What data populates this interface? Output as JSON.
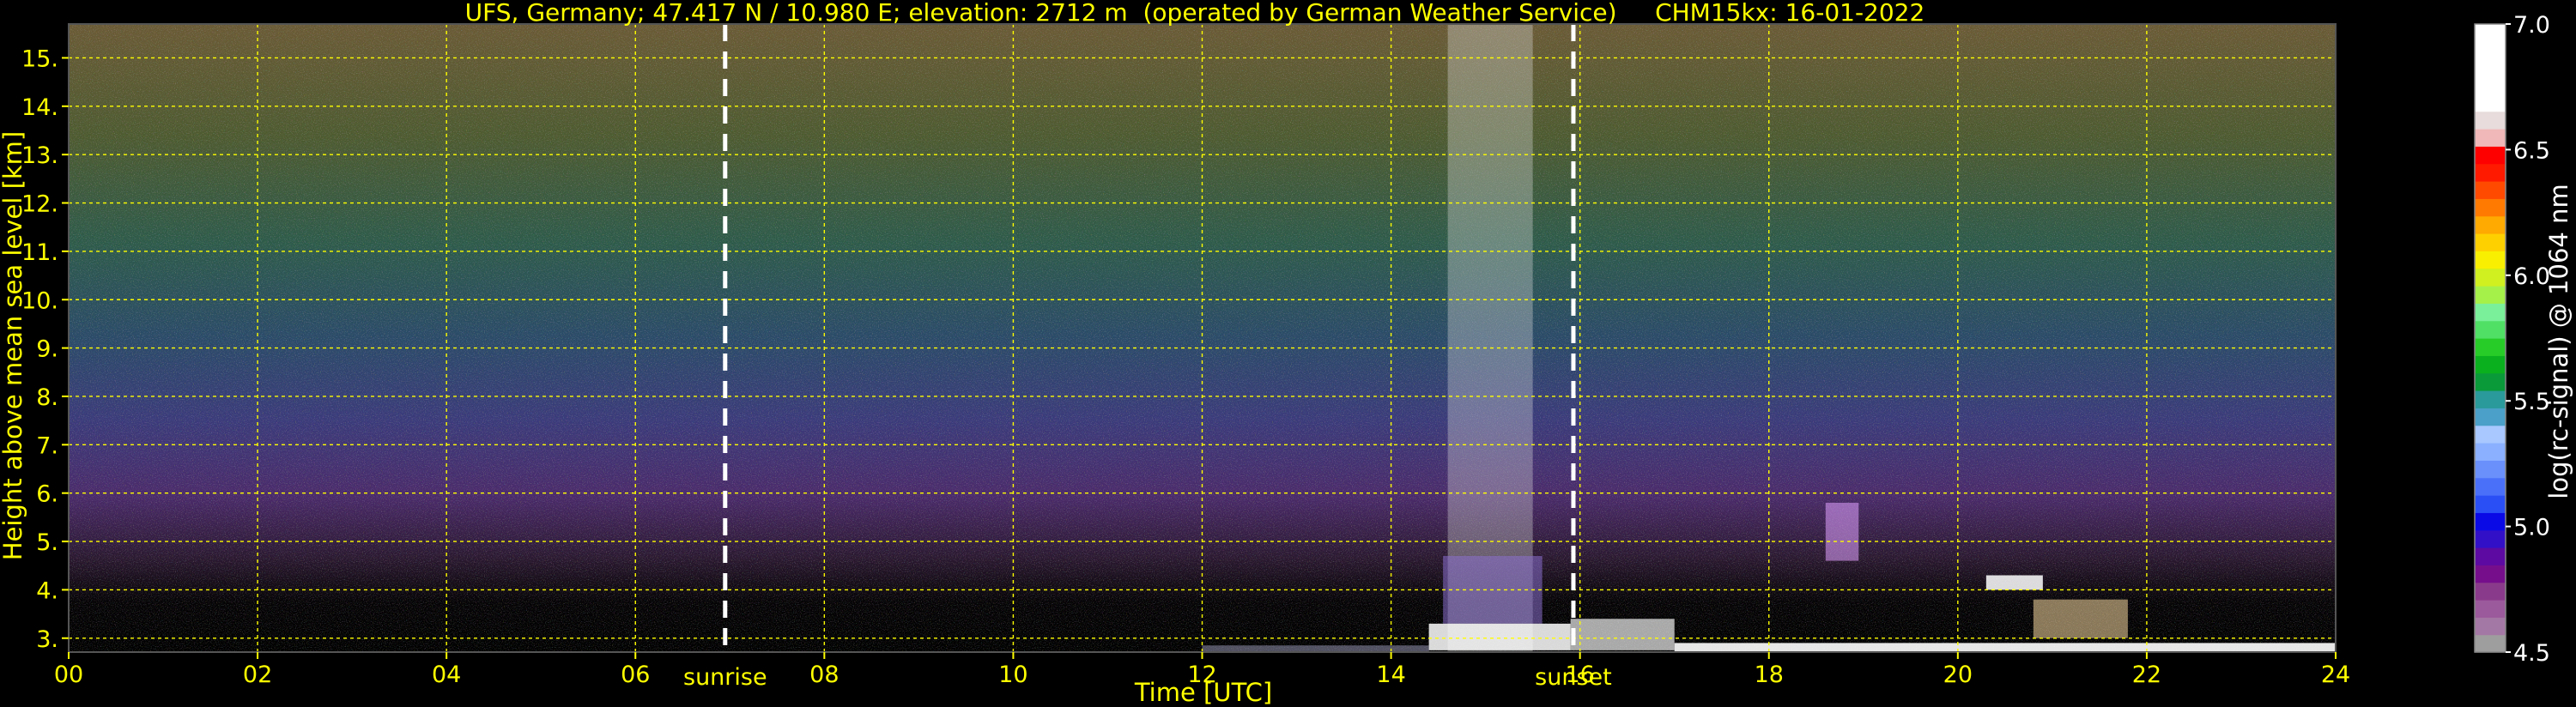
{
  "chart_data": {
    "type": "heatmap",
    "title": "UFS, Germany; 47.417 N / 10.980 E; elevation: 2712 m  (operated by German Weather Service)     CHM15kx: 16-01-2022",
    "xlabel": "Time [UTC]",
    "ylabel": "Height above mean sea level [km]",
    "xlim": [
      0,
      24
    ],
    "ylim": [
      2.712,
      15.7
    ],
    "x_ticks": [
      "00",
      "02",
      "04",
      "06",
      "08",
      "10",
      "12",
      "14",
      "16",
      "18",
      "20",
      "22",
      "24"
    ],
    "y_ticks": [
      "3.",
      "4.",
      "5.",
      "6.",
      "7.",
      "8.",
      "9.",
      "10.",
      "11.",
      "12.",
      "13.",
      "14.",
      "15."
    ],
    "grid": true,
    "markers": [
      {
        "label": "sunrise",
        "x": 6.95
      },
      {
        "label": "sunset",
        "x": 15.93
      }
    ],
    "colorbar": {
      "label": "log(rc-signal) @ 1064 nm",
      "range": [
        4.5,
        7.0
      ],
      "ticks": [
        "4.5",
        "5.0",
        "5.5",
        "6.0",
        "6.5",
        "7.0"
      ],
      "colors": [
        "#9e9e9e",
        "#a478a4",
        "#9b5a9b",
        "#8a3a8a",
        "#760e8c",
        "#5c0aa2",
        "#3210c8",
        "#0a0ae6",
        "#2a50f5",
        "#4a70fa",
        "#6a90fc",
        "#8ab0ff",
        "#a8c8ff",
        "#4aa0c8",
        "#2a9a9a",
        "#0a9a3a",
        "#0ab01e",
        "#28cc28",
        "#50e066",
        "#7af09a",
        "#a6f04a",
        "#d0f020",
        "#f8f000",
        "#ffd000",
        "#ffaa00",
        "#ff7a00",
        "#ff4a00",
        "#ff1a00",
        "#ff0000",
        "#f0b8b8",
        "#e8dcdc",
        "#ffffff",
        "#ffffff",
        "#ffffff",
        "#ffffff",
        "#ffffff"
      ]
    }
  }
}
